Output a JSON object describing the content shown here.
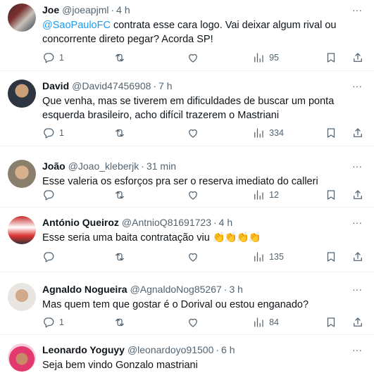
{
  "tweets": [
    {
      "name": "Joe",
      "handle": "@joeapjml",
      "time": "4 h",
      "mention": "@SaoPauloFC",
      "text": " contrata esse cara logo. Vai deixar algum rival ou concorrente direto pegar? Acorda SP!",
      "replies": "1",
      "retweets": "",
      "likes": "",
      "views": "95"
    },
    {
      "name": "David",
      "handle": "@David47456908",
      "time": "7 h",
      "mention": "",
      "text": "Que venha, mas se tiverem em dificuldades de buscar um ponta esquerda brasileiro, acho difícil trazerem o Mastriani",
      "replies": "1",
      "retweets": "",
      "likes": "",
      "views": "334"
    },
    {
      "name": "João",
      "handle": "@Joao_kleberjk",
      "time": "31 min",
      "mention": "",
      "text": "Esse valeria os esforços pra ser o reserva imediato do calleri",
      "replies": "",
      "retweets": "",
      "likes": "",
      "views": "12"
    },
    {
      "name": "António Queiroz",
      "handle": "@AntnioQ81691723",
      "time": "4 h",
      "mention": "",
      "text": "Esse seria uma baita contratação viu",
      "emoji": "👏👏👏👏",
      "replies": "",
      "retweets": "",
      "likes": "",
      "views": "135"
    },
    {
      "name": "Agnaldo Nogueira",
      "handle": "@AgnaldoNog85267",
      "time": "3 h",
      "mention": "",
      "text": "Mas quem tem que gostar é o Dorival ou estou enganado?",
      "replies": "1",
      "retweets": "",
      "likes": "",
      "views": "84"
    },
    {
      "name": "Leonardo Yoguyy",
      "handle": "@leonardoyo91500",
      "time": "6 h",
      "mention": "",
      "text": "Seja bem vindo Gonzalo mastriani"
    }
  ],
  "icons": {
    "more": "more-icon",
    "reply": "reply-icon",
    "retweet": "retweet-icon",
    "like": "heart-icon",
    "views": "views-icon",
    "bookmark": "bookmark-icon",
    "share": "share-icon"
  },
  "colors": {
    "text": "#0f1419",
    "secondary": "#536471",
    "link": "#1d9bf0",
    "divider": "#eff3f4"
  },
  "dot": "·",
  "more_glyph": "···"
}
